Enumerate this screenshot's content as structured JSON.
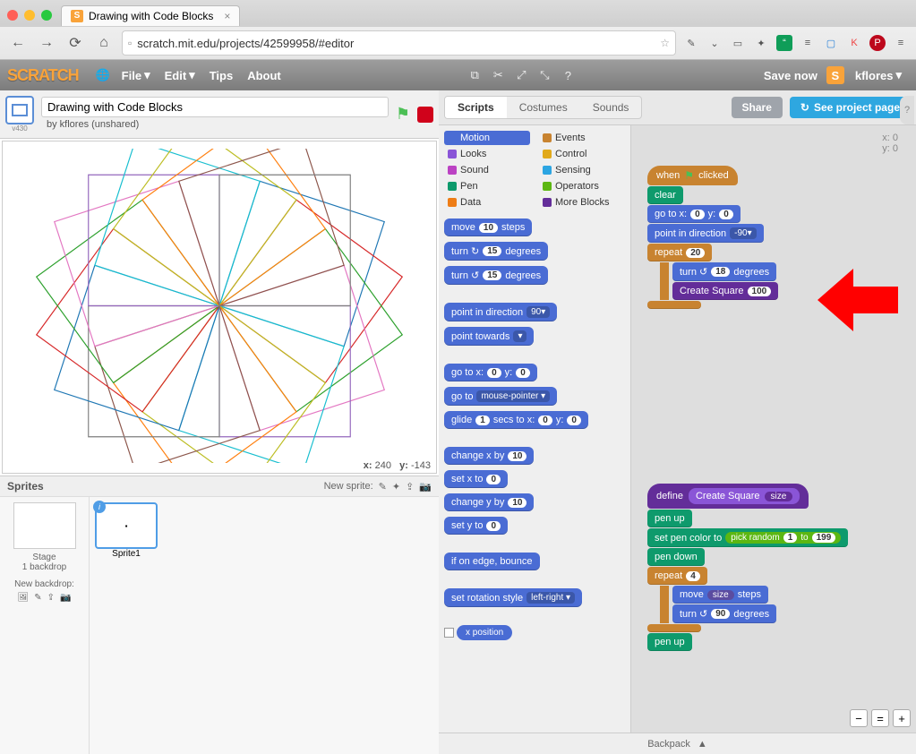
{
  "browser": {
    "tab_title": "Drawing with Code Blocks",
    "url": "scratch.mit.edu/projects/42599958/#editor"
  },
  "scratch_menu": {
    "logo": "SCRATCH",
    "file": "File",
    "edit": "Edit",
    "tips": "Tips",
    "about": "About",
    "save_now": "Save now",
    "username": "kflores"
  },
  "project": {
    "title": "Drawing with Code Blocks",
    "byline": "by kflores (unshared)",
    "version_label": "v430",
    "mouse_x_label": "x:",
    "mouse_x": "240",
    "mouse_y_label": "y:",
    "mouse_y": "-143"
  },
  "sprite_panel": {
    "label": "Sprites",
    "new_sprite": "New sprite:",
    "stage_label": "Stage",
    "backdrop_count": "1 backdrop",
    "new_backdrop": "New backdrop:",
    "sprite1": "Sprite1"
  },
  "tabs": {
    "scripts": "Scripts",
    "costumes": "Costumes",
    "sounds": "Sounds"
  },
  "buttons": {
    "share": "Share",
    "project_page": "See project page"
  },
  "categories": {
    "motion": "Motion",
    "looks": "Looks",
    "sound": "Sound",
    "pen": "Pen",
    "data": "Data",
    "events": "Events",
    "control": "Control",
    "sensing": "Sensing",
    "operators": "Operators",
    "more": "More Blocks"
  },
  "palette_blocks": {
    "move": {
      "a": "move",
      "n": "10",
      "b": "steps"
    },
    "turn_cw": {
      "a": "turn ↻",
      "n": "15",
      "b": "degrees"
    },
    "turn_ccw": {
      "a": "turn ↺",
      "n": "15",
      "b": "degrees"
    },
    "point_dir": {
      "a": "point in direction",
      "n": "90▾"
    },
    "point_towards": {
      "a": "point towards",
      "n": "▾"
    },
    "goto_xy": {
      "a": "go to x:",
      "x": "0",
      "b": "y:",
      "y": "0"
    },
    "goto": {
      "a": "go to",
      "n": "mouse-pointer ▾"
    },
    "glide": {
      "a": "glide",
      "s": "1",
      "b": "secs to x:",
      "x": "0",
      "c": "y:",
      "y": "0"
    },
    "chx": {
      "a": "change x by",
      "n": "10"
    },
    "setx": {
      "a": "set x to",
      "n": "0"
    },
    "chy": {
      "a": "change y by",
      "n": "10"
    },
    "sety": {
      "a": "set y to",
      "n": "0"
    },
    "bounce": "if on edge, bounce",
    "rot": {
      "a": "set rotation style",
      "n": "left-right ▾"
    },
    "xpos": "x position"
  },
  "script1": {
    "hat": "when",
    "hat2": "clicked",
    "clear": "clear",
    "goto_a": "go to x:",
    "goto_x": "0",
    "goto_b": "y:",
    "goto_y": "0",
    "point_a": "point in direction",
    "point_v": "-90▾",
    "repeat": "repeat",
    "repeat_n": "20",
    "turn_a": "turn ↺",
    "turn_n": "18",
    "turn_b": "degrees",
    "call": "Create Square",
    "call_arg": "100"
  },
  "script2": {
    "define": "define",
    "name": "Create Square",
    "arg": "size",
    "penup": "pen up",
    "setcolor": "set pen color to",
    "pick": "pick random",
    "p1": "1",
    "to": "to",
    "p2": "199",
    "pendown": "pen down",
    "repeat": "repeat",
    "repeat_n": "4",
    "move_a": "move",
    "move_arg": "size",
    "move_b": "steps",
    "turn_a": "turn ↺",
    "turn_n": "90",
    "turn_b": "degrees",
    "penup2": "pen up"
  },
  "readout": {
    "x_label": "x:",
    "x": "0",
    "y_label": "y:",
    "y": "0"
  },
  "backpack": {
    "label": "Backpack"
  }
}
